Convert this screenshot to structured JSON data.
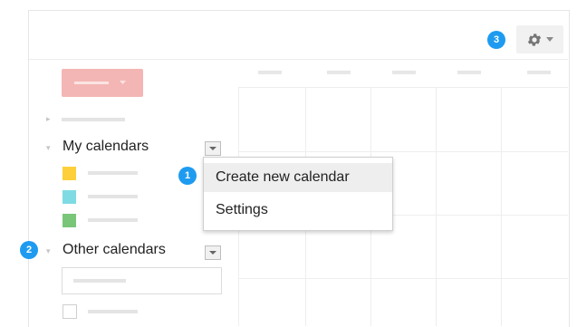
{
  "badges": {
    "one": "1",
    "two": "2",
    "three": "3"
  },
  "sidebar": {
    "my_calendars_label": "My calendars",
    "other_calendars_label": "Other calendars",
    "calendar_colors": [
      "#fdcf3a",
      "#7fdbe3",
      "#79c679"
    ]
  },
  "menu": {
    "items": [
      {
        "label": "Create new calendar"
      },
      {
        "label": "Settings"
      }
    ]
  },
  "icons": {
    "settings": "gear-icon",
    "dropdown": "chevron-down-icon",
    "expand": "triangle-right-icon"
  },
  "colors": {
    "badge": "#1e9bf0",
    "create_button": "#f3b6b4"
  }
}
